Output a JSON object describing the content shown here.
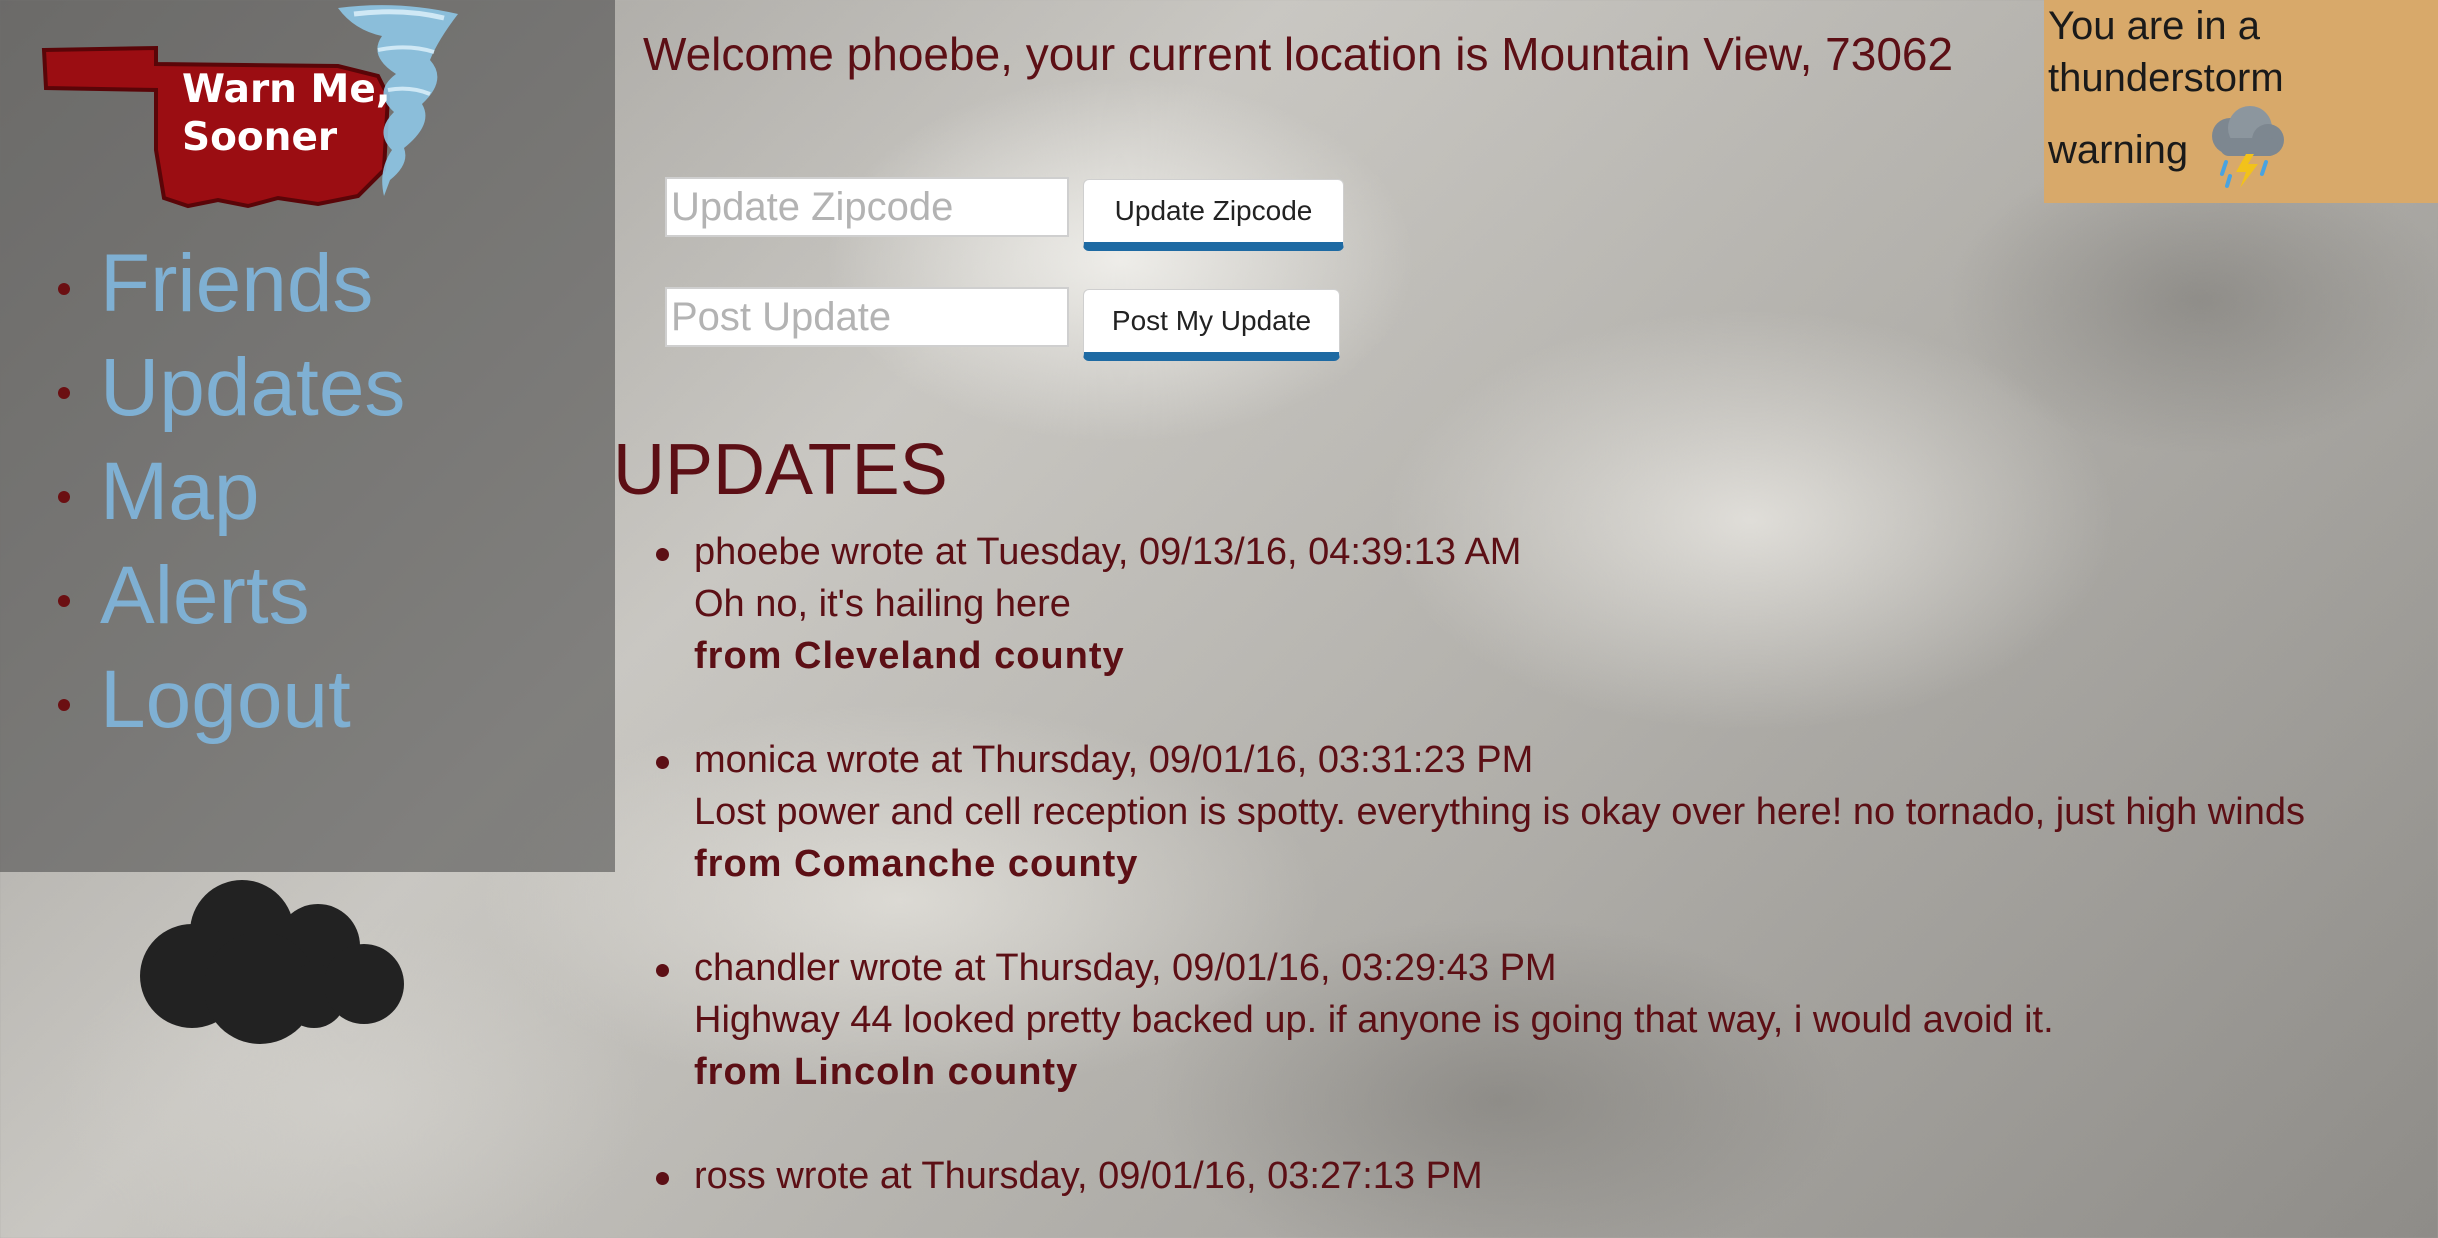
{
  "logo": {
    "text": "Warn Me,\nSooner",
    "state_color": "#9b0d12",
    "tornado_color": "#8ec6e6"
  },
  "sidebar": {
    "items": [
      {
        "label": "Friends"
      },
      {
        "label": "Updates"
      },
      {
        "label": "Map"
      },
      {
        "label": "Alerts"
      },
      {
        "label": "Logout"
      }
    ]
  },
  "header": {
    "welcome": "Welcome phoebe, your current location is Mountain View, 73062"
  },
  "forms": {
    "zipcode_placeholder": "Update Zipcode",
    "zipcode_button": "Update Zipcode",
    "post_placeholder": "Post Update",
    "post_button": "Post My Update"
  },
  "updates": {
    "heading": "UPDATES",
    "items": [
      {
        "header": "phoebe wrote at Tuesday, 09/13/16, 04:39:13 AM",
        "message": "Oh no, it's hailing here",
        "county": "from Cleveland county"
      },
      {
        "header": "monica wrote at Thursday, 09/01/16, 03:31:23 PM",
        "message": "Lost power and cell reception is spotty. everything is okay over here! no tornado, just high winds",
        "county": "from Comanche county"
      },
      {
        "header": "chandler wrote at Thursday, 09/01/16, 03:29:43 PM",
        "message": "Highway 44 looked pretty backed up. if anyone is going that way, i would avoid it.",
        "county": "from Lincoln county"
      },
      {
        "header": "ross wrote at Thursday, 09/01/16, 03:27:13 PM"
      }
    ]
  },
  "alert": {
    "line1": "You are in a",
    "line2": "thunderstorm",
    "line3": "warning",
    "icon": "thunderstorm-icon",
    "background": "#d8a96a"
  },
  "colors": {
    "text_primary": "#5c0f15",
    "nav_link": "#7fb0d3",
    "button_accent": "#1e6aa3"
  }
}
